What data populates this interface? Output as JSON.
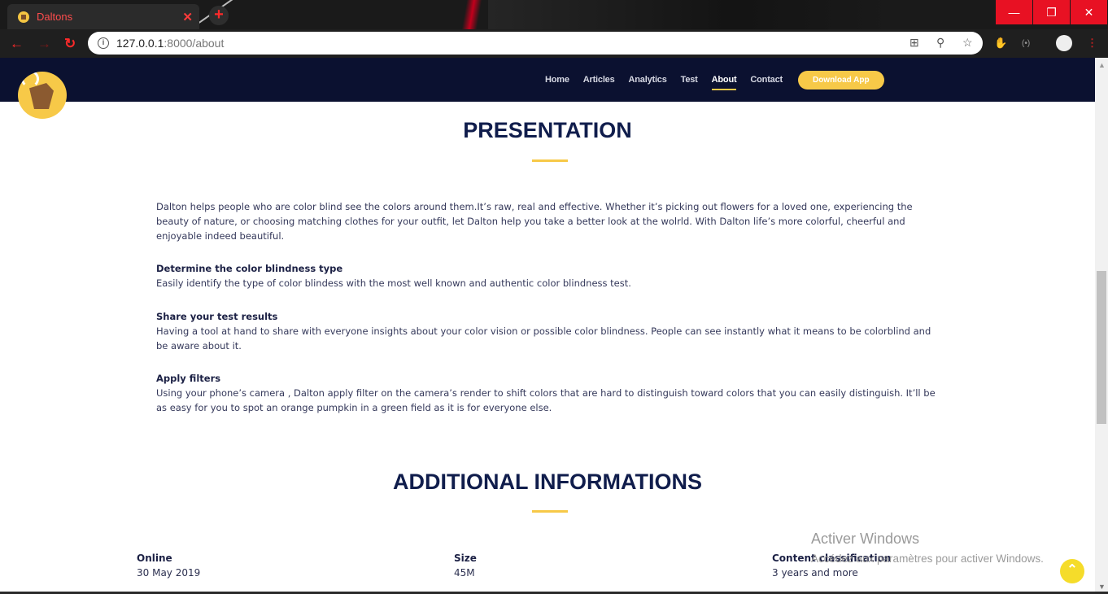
{
  "browser": {
    "tab_title": "Daltons",
    "tab_close": "✕",
    "new_tab": "+",
    "url_host": "127.0.0.1",
    "url_path": ":8000/about",
    "window_minimize": "—",
    "window_restore": "❐",
    "window_close": "✕"
  },
  "nav": {
    "items": [
      {
        "label": "Home"
      },
      {
        "label": "Articles"
      },
      {
        "label": "Analytics"
      },
      {
        "label": "Test"
      },
      {
        "label": "About"
      },
      {
        "label": "Contact"
      }
    ],
    "download_label": "Download App"
  },
  "presentation": {
    "title": "PRESENTATION",
    "intro": "Dalton helps people who are color blind see the colors around them.It’s raw, real and effective. Whether it’s picking out flowers for a loved one, experiencing the beauty of nature, or choosing matching clothes for your outfit, let Dalton help you take a better look at the wolrld. With Dalton life’s more colorful, cheerful and enjoyable indeed beautiful.",
    "features": [
      {
        "heading": "Determine the color blindness type",
        "text": "Easily identify the type of color blindess with the most well known and authentic color blindness test."
      },
      {
        "heading": "Share your test results",
        "text": "Having a tool at hand to share with everyone insights about your color vision or possible color blindness. People can see instantly what it means to be colorblind and be aware about it."
      },
      {
        "heading": "Apply filters",
        "text": "Using your phone’s camera , Dalton apply filter on the camera’s render to shift colors that are hard to distinguish toward colors that you can easily distinguish. It’ll be as easy for you to spot an orange pumpkin in a green field as it is for everyone else."
      }
    ]
  },
  "additional": {
    "title": "ADDITIONAL INFORMATIONS",
    "items": [
      {
        "label": "Online",
        "value": "30 May 2019"
      },
      {
        "label": "Size",
        "value": "45M"
      },
      {
        "label": "Content classification",
        "value": "3 years and more"
      }
    ]
  },
  "watermark": {
    "line1": "Activer Windows",
    "line2": "Accédez aux paramètres pour activer Windows."
  },
  "colors": {
    "header_bg": "#0b1130",
    "accent": "#f7c948",
    "heading": "#101d4c",
    "browser_accent": "#ff2a2a"
  }
}
